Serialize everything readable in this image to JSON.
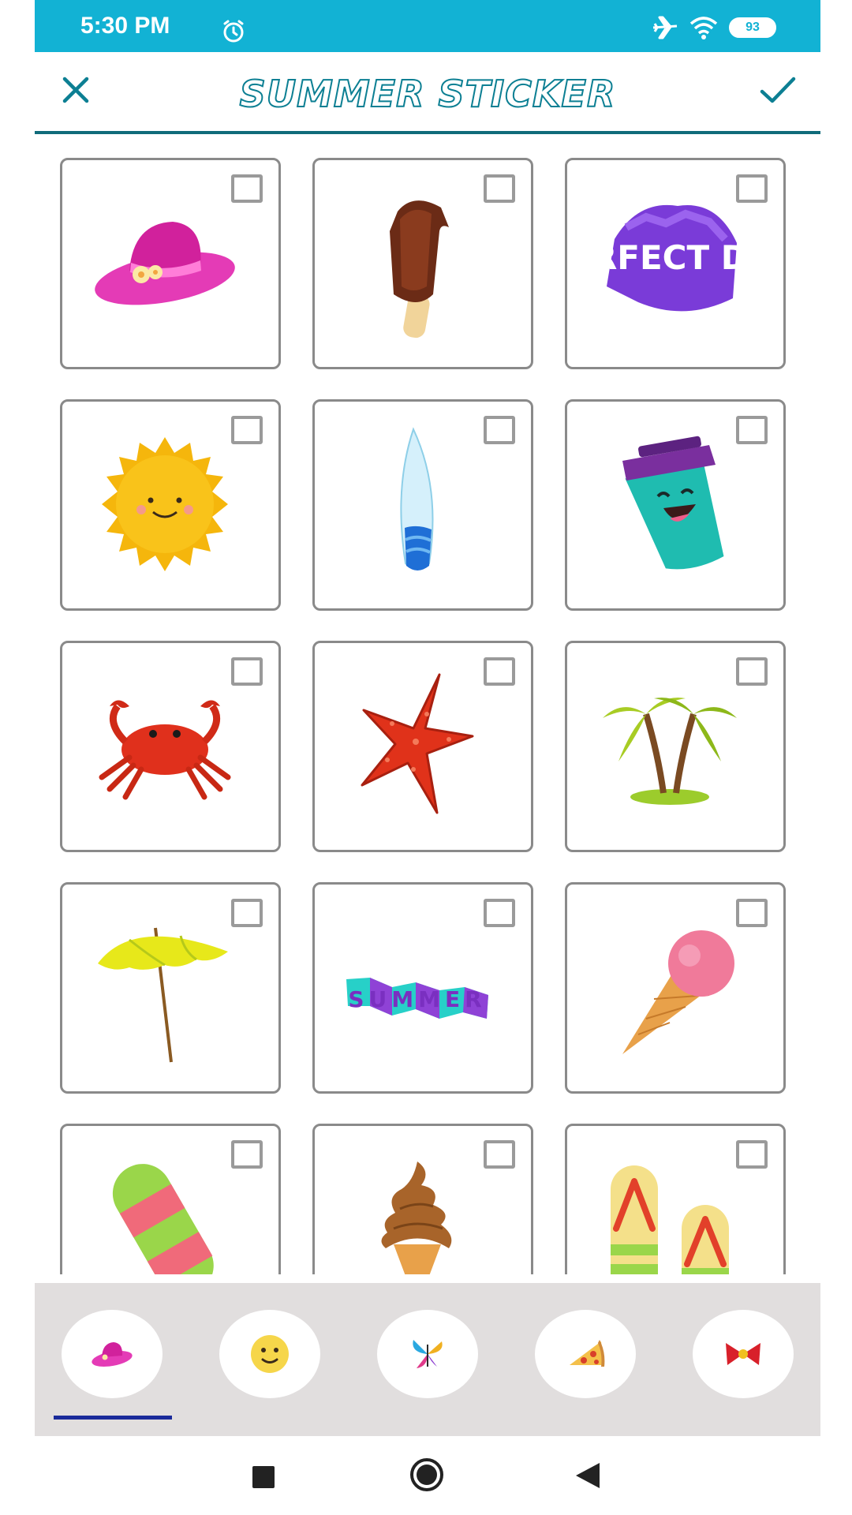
{
  "status_bar": {
    "time": "5:30 PM",
    "battery": "93",
    "icons": [
      "alarm-icon",
      "airplane-mode-icon",
      "wifi-icon",
      "battery-icon"
    ]
  },
  "header": {
    "title": "SUMMER STICKER",
    "close_icon": "close-icon",
    "confirm_icon": "checkmark-icon",
    "accent_color": "#0c7f93"
  },
  "stickers": [
    {
      "name": "sun-hat",
      "checked": false
    },
    {
      "name": "chocolate-popsicle",
      "checked": false
    },
    {
      "name": "perfect-day-badge",
      "text": "PERFECT DAY",
      "checked": false
    },
    {
      "name": "smiling-sun",
      "checked": false
    },
    {
      "name": "surfboard",
      "checked": false
    },
    {
      "name": "smiling-cup",
      "checked": false
    },
    {
      "name": "crab",
      "checked": false
    },
    {
      "name": "starfish",
      "checked": false
    },
    {
      "name": "palm-trees",
      "checked": false
    },
    {
      "name": "beach-umbrella",
      "checked": false
    },
    {
      "name": "summer-banner",
      "text": "SUMMER",
      "checked": false
    },
    {
      "name": "ice-cream-cone",
      "checked": false
    },
    {
      "name": "striped-popsicle",
      "checked": false
    },
    {
      "name": "soft-serve-cone",
      "checked": false
    },
    {
      "name": "flip-flops",
      "checked": false
    }
  ],
  "category_tabs": [
    {
      "name": "hat-category",
      "selected": true
    },
    {
      "name": "smiley-category",
      "selected": false
    },
    {
      "name": "butterfly-category",
      "selected": false
    },
    {
      "name": "pizza-category",
      "selected": false
    },
    {
      "name": "bow-category",
      "selected": false
    }
  ],
  "navigation": [
    "recents-icon",
    "home-icon",
    "back-icon"
  ],
  "colors": {
    "status_bar": "#12b2d4",
    "tab_bar": "#e1dede",
    "tab_indicator": "#1a2a9a"
  }
}
